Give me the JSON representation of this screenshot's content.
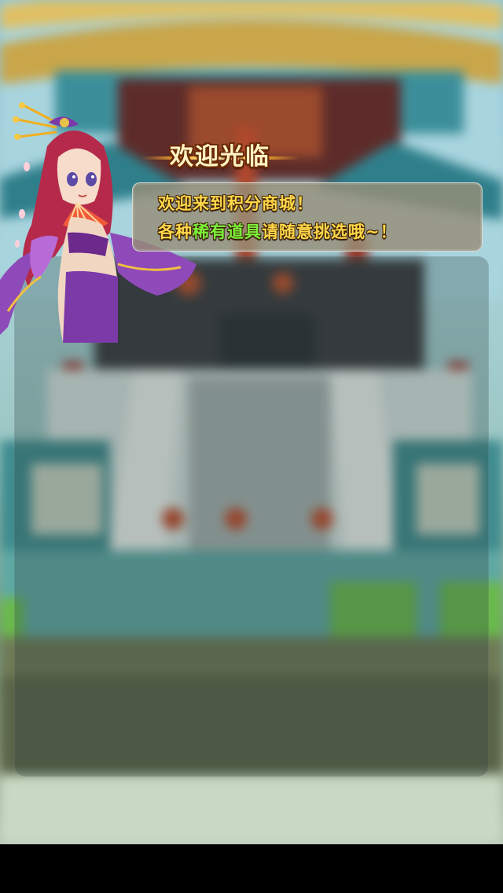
{
  "title_banner": {
    "text": "欢迎光临"
  },
  "speech": {
    "line1": "欢迎来到积分商城！",
    "line2_parts": [
      {
        "text": "各种",
        "color": "yellow"
      },
      {
        "text": "稀有道具",
        "color": "green"
      },
      {
        "text": "请随意挑选哦~！",
        "color": "yellow"
      }
    ]
  },
  "colors": {
    "yellow": "#ffd84a",
    "green": "#7cf23a",
    "panel": "#2a3c3a",
    "banner_outline": "#6a2a08"
  },
  "icons": {
    "character": "npc-maiden-with-fan"
  }
}
